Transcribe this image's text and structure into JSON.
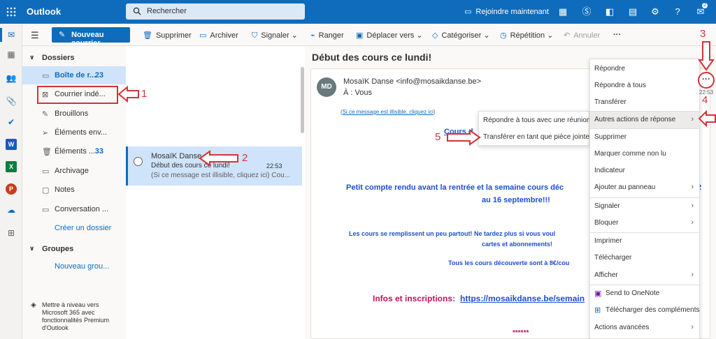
{
  "topbar": {
    "app_name": "Outlook",
    "search_placeholder": "Rechercher",
    "join_label": "Rejoindre maintenant",
    "notifications_count": "2"
  },
  "toolbar": {
    "new_mail": "Nouveau courrier",
    "delete": "Supprimer",
    "archive": "Archiver",
    "report": "Signaler",
    "sweep": "Ranger",
    "move": "Déplacer vers",
    "categorize": "Catégoriser",
    "repeat": "Répétition",
    "undo": "Annuler",
    "more": "···"
  },
  "folders": {
    "header": "Dossiers",
    "items": [
      {
        "label": "Boîte de r...",
        "count": "23"
      },
      {
        "label": "Courrier indé..."
      },
      {
        "label": "Brouillons"
      },
      {
        "label": "Éléments env..."
      },
      {
        "label": "Éléments ...",
        "count": "33"
      },
      {
        "label": "Archivage"
      },
      {
        "label": "Notes"
      },
      {
        "label": "Conversation ..."
      }
    ],
    "create_folder": "Créer un dossier",
    "groups_header": "Groupes",
    "new_group": "Nouveau grou..."
  },
  "upgrade_text": "Mettre à niveau vers Microsoft 365 avec fonctionnalités Premium d'Outlook",
  "message_list": {
    "item": {
      "sender": "MosaïK Danse",
      "subject": "Début des cours ce lundi!",
      "time": "22:53",
      "preview": "(Si ce message est illisible, cliquez ici) Cou..."
    }
  },
  "reading": {
    "subject": "Début des cours ce lundi!",
    "avatar": "MD",
    "from": "MosaïK Danse <info@mosaikdanse.be>",
    "to": "À :  Vous",
    "time": "22:53",
    "notice": "Si ce message est illisible, cliquez ici",
    "body": {
      "heading": "Cours d",
      "line1a": "Petit compte rendu avant la rentrée et la semaine cours déc",
      "line1b": "au 16 septembre!!!",
      "line1c": "2",
      "line2a": "Les cours se remplissent un peu partout! Ne tardez plus si vous voul",
      "line2b": "cartes et abonnements!",
      "line3": "Tous les cours découverte sont à 8€/cou",
      "line4_label": "Infos et inscriptions: ",
      "line4_link": "https://mosaikdanse.be/semain",
      "stars": "******"
    }
  },
  "context_menu": {
    "items": [
      "Répondre",
      "Répondre à tous",
      "Transférer",
      "Autres actions de réponse",
      "Supprimer",
      "Marquer comme non lu",
      "Indicateur",
      "Ajouter au panneau",
      "Signaler",
      "Bloquer",
      "Imprimer",
      "Télécharger",
      "Afficher",
      "Send to OneNote",
      "Télécharger des compléments",
      "Actions avancées"
    ]
  },
  "submenu": {
    "items": [
      "Répondre à tous avec une réunion",
      "Transférer en tant que pièce jointe"
    ]
  },
  "annotations": {
    "n1": "1",
    "n2": "2",
    "n3": "3",
    "n4": "4",
    "n5": "5"
  },
  "colors": {
    "brand": "#0f6cbd",
    "annotation_red": "#d13438",
    "body_blue": "#1e4fd1",
    "body_red": "#c4125a"
  }
}
